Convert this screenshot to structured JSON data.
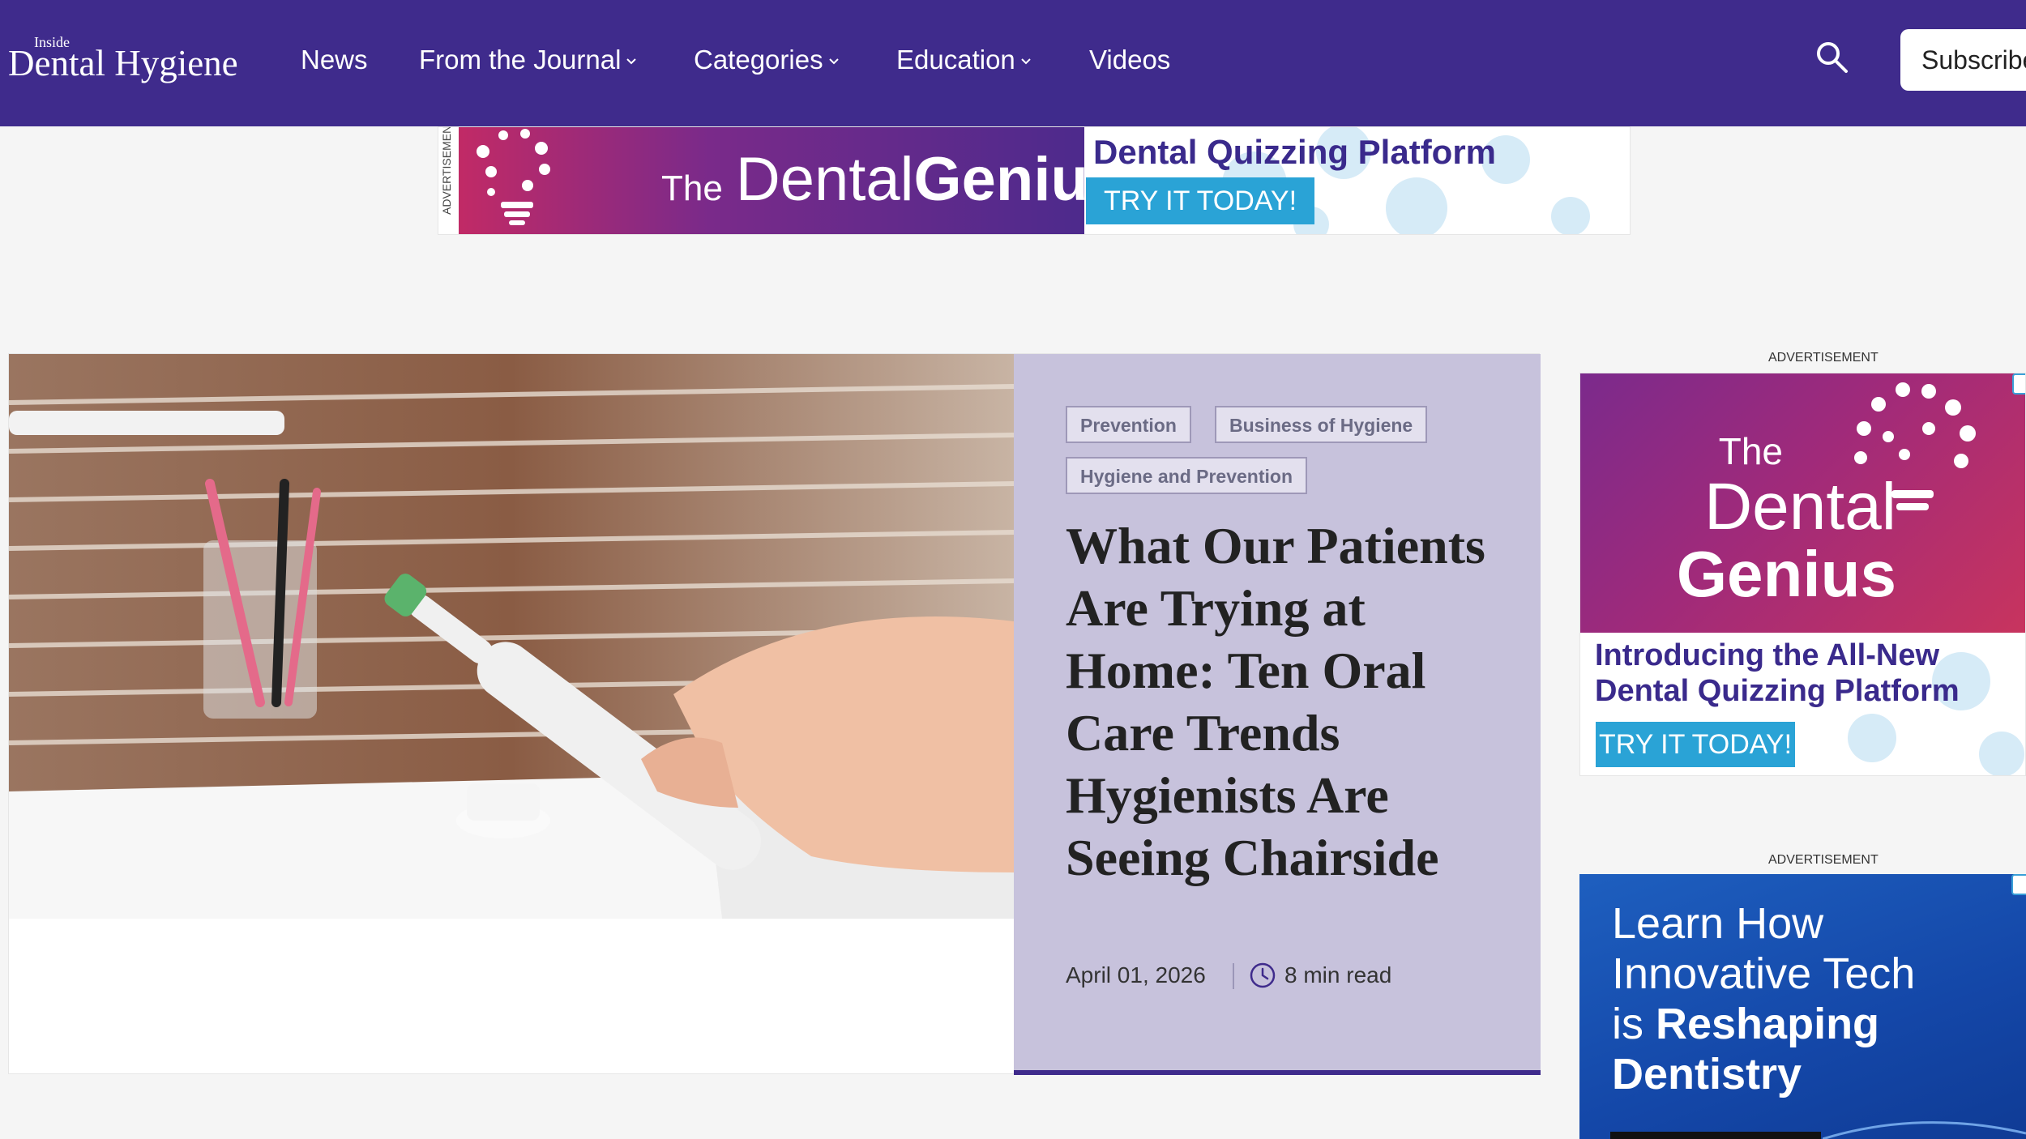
{
  "header": {
    "logo_small": "Inside",
    "logo_big": "Dental Hygiene",
    "nav": [
      {
        "label": "News",
        "has_dropdown": false
      },
      {
        "label": "From the Journal",
        "has_dropdown": true
      },
      {
        "label": "Categories",
        "has_dropdown": true
      },
      {
        "label": "Education",
        "has_dropdown": true
      },
      {
        "label": "Videos",
        "has_dropdown": false
      }
    ],
    "search_icon": "search-icon",
    "subscribe_label": "Subscribe",
    "brand_color": "#3f2b8c"
  },
  "top_ad": {
    "label": "ADVERTISEMENT",
    "brand_the": "The",
    "brand_dental": "Dental",
    "brand_genius": "Genius",
    "headline": "Dental Quizzing Platform",
    "cta": "TRY IT TODAY!"
  },
  "feature": {
    "image_alt": "Hand holding an electric toothbrush beside a cup of toothbrushes",
    "tags": [
      "Prevention",
      "Business of Hygiene",
      "Hygiene and Prevention"
    ],
    "title": "What Our Patients Are Trying at Home: Ten Oral Care Trends Hygienists Are Seeing Chairside",
    "date": "April 01, 2026",
    "read_time": "8 min read",
    "clock_icon": "clock-icon",
    "panel_color": "#c7c2dc"
  },
  "rail": {
    "ad1": {
      "label": "ADVERTISEMENT",
      "brand_the": "The",
      "brand_dental": "Dental",
      "brand_genius": "Genius",
      "copy_line1": "Introducing the All-New",
      "copy_line2": "Dental Quizzing Platform",
      "cta": "TRY IT TODAY!"
    },
    "ad2": {
      "label": "ADVERTISEMENT",
      "text_line1": "Learn How",
      "text_line2": "Innovative Tech",
      "text_line3_pre": "is ",
      "text_line3_bold": "Reshaping",
      "text_line4": "Dentistry"
    }
  },
  "colors": {
    "accent_blue": "#2aa3d6",
    "ad_purple_text": "#3a2a8c"
  }
}
